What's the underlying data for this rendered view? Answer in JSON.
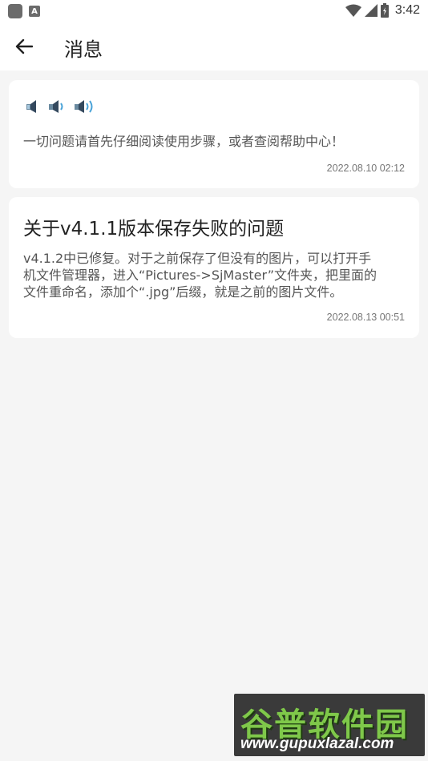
{
  "status_bar": {
    "time": "3:42",
    "icons": [
      "app-icon",
      "a-icon",
      "wifi-icon",
      "signal-icon",
      "battery-icon"
    ]
  },
  "appbar": {
    "back_icon": "arrow-left-icon",
    "title": "消息"
  },
  "messages": [
    {
      "icon": "speaker-volume-icons",
      "text": "一切问题请首先仔细阅读使用步骤，或者查阅帮助中心！",
      "date": "2022.08.10 02:12"
    },
    {
      "title": "关于v4.1.1版本保存失败的问题",
      "text_lines": [
        "v4.1.2中已修复。对于之前保存了但没有的图片，可以打开手",
        "机文件管理器，进入“Pictures->SjMaster”文件夹，把里面的",
        "文件重命名，添加个“.jpg”后缀，就是之前的图片文件。"
      ],
      "date": "2022.08.13 00:51"
    }
  ],
  "watermark": {
    "title": "谷普软件园",
    "url": "www.gupuxlazal.com"
  },
  "colors": {
    "background": "#f5f5f5",
    "card": "#ffffff",
    "speaker_blue": "#4aa3d8",
    "watermark_green": "#7fc84a"
  }
}
